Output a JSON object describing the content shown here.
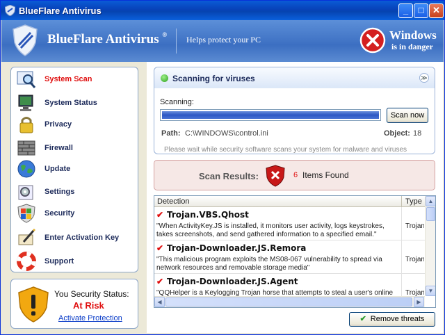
{
  "window": {
    "title": "BlueFlare Antivirus",
    "controls": [
      "_",
      "□",
      "✕"
    ]
  },
  "header": {
    "brand": "BlueFlare Antivirus",
    "trademark": "®",
    "tagline": "Helps protect your PC",
    "alert_line1": "Windows",
    "alert_line2": "is in danger"
  },
  "sidebar": {
    "items": [
      {
        "label": "System Scan",
        "icon": "magnifier-icon",
        "active": true
      },
      {
        "label": "System Status",
        "icon": "monitor-icon"
      },
      {
        "label": "Privacy",
        "icon": "padlock-icon"
      },
      {
        "label": "Firewall",
        "icon": "brick-wall-icon"
      },
      {
        "label": "Update",
        "icon": "globe-icon"
      },
      {
        "label": "Settings",
        "icon": "settings-gear-icon"
      },
      {
        "label": "Security",
        "icon": "windows-shield-icon"
      },
      {
        "label": "Enter Activation Key",
        "icon": "pen-key-icon"
      },
      {
        "label": "Support",
        "icon": "lifebuoy-icon"
      }
    ]
  },
  "status": {
    "title": "You Security Status:",
    "value": "At Risk",
    "link": "Activate Protection"
  },
  "scan": {
    "title": "Scanning for viruses",
    "collapse_glyph": "≫",
    "scanning_label": "Scanning:",
    "progress_fraction": 1.0,
    "button": "Scan now",
    "path_label": "Path:",
    "path_value": "C:\\WINDOWS\\control.ini",
    "object_label": "Object:",
    "object_value": "18",
    "wait_text": "Please wait while security software scans your system for malware and viruses"
  },
  "results": {
    "label": "Scan Results:",
    "count": "6",
    "items_text": "Items Found"
  },
  "table": {
    "columns": [
      "Detection",
      "Type"
    ],
    "rows": [
      {
        "name": "Trojan.VBS.Qhost",
        "desc": "\"When ActivityKey.JS is installed, it monitors user activity, logs keystrokes, takes screenshots, and send gathered information to a specified email.\"",
        "type": "Trojan"
      },
      {
        "name": "Trojan-Downloader.JS.Remora",
        "desc": "\"This malicious program exploits the MS08-067 vulnerability to spread via network resources and removable storage media\"",
        "type": "Trojan"
      },
      {
        "name": "Trojan-Downloader.JS.Agent",
        "desc": "\"QQHelper is a Keylogging Trojan horse that attempts to steal a user's online",
        "type": "Trojan"
      }
    ]
  },
  "remove_button": "Remove threats",
  "colors": {
    "danger": "#e01010",
    "brand_blue": "#3c6fc2",
    "link": "#0a3cc8"
  }
}
